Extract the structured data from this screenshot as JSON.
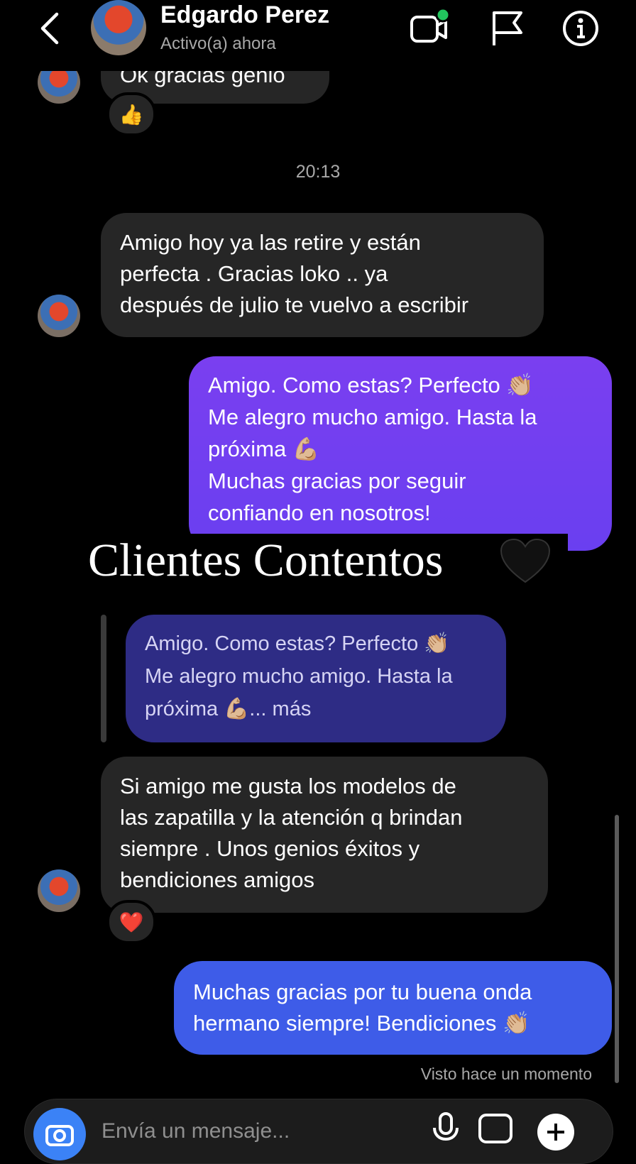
{
  "header": {
    "back_label": "Atrás",
    "contact_name": "Edgardo Perez",
    "contact_status": "Activo(a) ahora",
    "icons": [
      "video-call-icon",
      "flag-icon",
      "info-icon"
    ],
    "online_dot_color": "#22c55e"
  },
  "messages": {
    "partial_text": "Ok gracias genio",
    "reaction_1": "👍",
    "timestamp": "20:13",
    "incoming_1": "Amigo hoy ya las retire y están\nperfecta . Gracias loko .. ya\ndespués de julio te vuelvo a escribir",
    "outgoing_1": "Amigo. Como estas? Perfecto 👏🏼\nMe alegro mucho amigo. Hasta la\npróxima  💪🏼\nMuchas gracias por seguir\nconfiando en nosotros!",
    "reply_quote": "Amigo. Como estas? Perfecto 👏🏼\nMe alegro mucho amigo. Hasta la\npróxima  💪🏼... más",
    "incoming_2": "Si amigo me gusta los modelos de\nlas  zapatilla y la atención q brindan\nsiempre . Unos genios éxitos y\nbendiciones amigos",
    "reaction_2": "❤️",
    "outgoing_2": "Muchas gracias por tu buena onda\nhermano siempre! Bendiciones 👏🏼",
    "seen": "Visto hace un momento"
  },
  "overlay": {
    "title": "Clientes Contentos"
  },
  "composer": {
    "placeholder": "Envía un mensaje..."
  },
  "colors": {
    "outgoing_purple": "#7a3ff0",
    "outgoing_blue": "#3e5ce8",
    "reply_bubble": "#2e2c85",
    "incoming": "#262626"
  }
}
